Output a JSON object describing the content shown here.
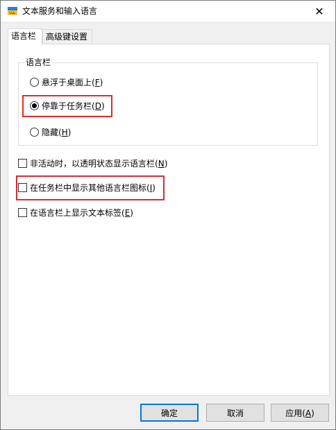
{
  "window": {
    "title": "文本服务和输入语言",
    "close_glyph": "✕"
  },
  "tabs": [
    {
      "label": "语言栏",
      "active": true
    },
    {
      "label": "高级键设置",
      "active": false
    }
  ],
  "language_bar_group": {
    "legend": "语言栏",
    "options": [
      {
        "label": "悬浮于桌面上",
        "key": "F",
        "checked": false
      },
      {
        "label": "停靠于任务栏",
        "key": "D",
        "checked": true
      },
      {
        "label": "隐藏",
        "key": "H",
        "checked": false
      }
    ]
  },
  "checkboxes": [
    {
      "label": "非活动时，以透明状态显示语言栏",
      "key": "N",
      "checked": false
    },
    {
      "label": "在任务栏中显示其他语言栏图标",
      "key": "I",
      "checked": false
    },
    {
      "label": "在语言栏上显示文本标签",
      "key": "E",
      "checked": false
    }
  ],
  "buttons": {
    "ok": "确定",
    "cancel": "取消",
    "apply_label": "应用",
    "apply_key": "A"
  },
  "colors": {
    "highlight": "#e8262a",
    "default_button_border": "#0078d7"
  }
}
